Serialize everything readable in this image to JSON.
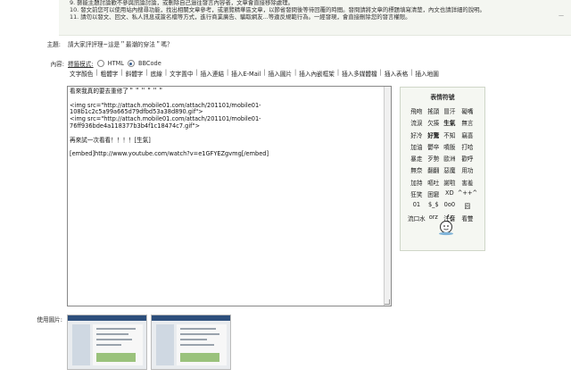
{
  "rules": [
    "9. 藝能主題討論歡不參與訊論討論，或刪除自己過往發言內容者，文章會直接移除處理。",
    "10. 發文前您可以使用站內搜尋功能，找出相關文章參考，或瀏覽精華區文章，以節省發問後等待回覆的時間。發問請將文章的標題填寫清楚，內文也請詳細的說明。",
    "11. 請勿以發文、回文、私人訊息或簽名檔等方式，進行商業廣告、騙取網友...等違反規範行為。一經發現，會直接刪除您的發言權限。"
  ],
  "form": {
    "subject_label": "主題:",
    "subject_value": "請大家評評理~這是＂最潮的穿法＂嗎？",
    "content_label": "內容:",
    "mode_prefix": "標籤模式:",
    "mode_html": "HTML",
    "mode_bbcode": "BBCode",
    "images_label": "使用圖片:"
  },
  "toolbar": [
    "文字顏色",
    "粗體字",
    "斜體字",
    "底線",
    "文字置中",
    "插入連結",
    "插入E-Mail",
    "插入圖片",
    "插入內嵌框架",
    "插入多媒體檔",
    "插入表格",
    "插入地圖"
  ],
  "editor_lines": [
    "看來我真的要去重修了＂＂＂＂＂＂",
    "",
    "<img src=\"http://attach.mobile01.com/attach/201101/mobile01-",
    "108b1c2c5a99a665d79dfbd53a38d890.gif\">",
    "<img src=\"http://attach.mobile01.com/attach/201101/mobile01-",
    "76ff936bde4a118377b3b4f1c18474c7.gif\">",
    "",
    "再來試一次看看！！！！[生氣]",
    "",
    "[embed]http://www.youtube.com/watch?v=e1GFYEZgvmg[/embed]"
  ],
  "emoticons": {
    "title": "表情符號",
    "items": [
      "飛吻",
      "搖頭",
      "冒汗",
      "礙嘴",
      "流淚",
      "欠揍",
      "生氣",
      "無言",
      "好冷",
      "好驚",
      "不知",
      "竊喜",
      "加油",
      "鬱卒",
      "噴飯",
      "打哈",
      "暴走",
      "歹勢",
      "歐洲",
      "歡呼",
      "無奈",
      "翻翻",
      "惡魔",
      "用功",
      "加持",
      "嘔吐",
      "謝啦",
      "害羞",
      "狂笑",
      "困窘",
      "XD",
      "^++^",
      "01",
      "$_$",
      "0o0",
      "囧",
      "流口水",
      "orz",
      "注音",
      "看雙"
    ],
    "bold_items": [
      "生氣",
      "好驚"
    ]
  },
  "scroll_hint": "—"
}
